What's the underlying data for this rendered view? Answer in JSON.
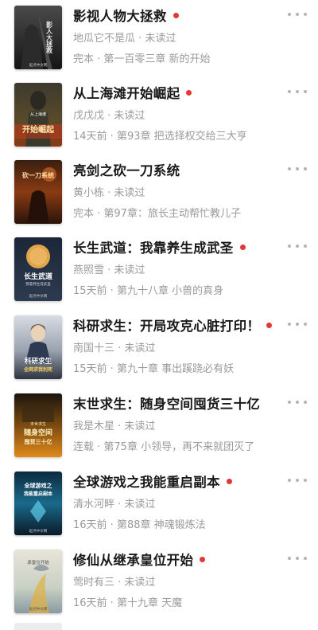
{
  "colors": {
    "accent_dot": "#e23838",
    "meta_text": "#9a9a9a",
    "more_dots": "#b5b5b5"
  },
  "books": [
    {
      "title": "影视人物大拯救",
      "dot": true,
      "meta": "地瓜它不是瓜 · 未读过",
      "progress": "完本 · 第一百零三章 新的开始",
      "cover": {
        "text": "影人大拯救",
        "footer": "起点中文网"
      }
    },
    {
      "title": "从上海滩开始崛起",
      "dot": true,
      "meta": "戊戊戊 · 未读过",
      "progress": "14天前 · 第93章 把选择权交给三大亨",
      "cover": {
        "text": "开始崛起",
        "top": "从上海滩"
      }
    },
    {
      "title": "亮剑之砍一刀系统",
      "dot": false,
      "meta": "黄小栋 · 未读过",
      "progress": "完本 · 第97章：旅长主动帮忙教儿子",
      "cover": {
        "text": "砍一刀系统"
      }
    },
    {
      "title": "长生武道：我靠养生成武圣",
      "dot": true,
      "meta": "燕照雪 · 未读过",
      "progress": "15天前 · 第九十八章 小兽的真身",
      "cover": {
        "text": "长生武道",
        "sub": "我靠养生成武圣",
        "footer": "起点中文网"
      }
    },
    {
      "title": "科研求生：开局攻克心脏打印！",
      "dot": true,
      "meta": "南国十三 · 未读过",
      "progress": "15天前 · 第九十章 事出蹊跷必有妖",
      "cover": {
        "text": "科研求生",
        "sub": "全网求我别死"
      }
    },
    {
      "title": "末世求生：随身空间囤货三十亿",
      "dot": false,
      "meta": "我是木星 · 未读过",
      "progress": "连载 · 第75章 小领导，再不来就团灭了",
      "cover": {
        "text": "随身空间",
        "sub": "囤货三十亿",
        "top": "末世求生"
      }
    },
    {
      "title": "全球游戏之我能重启副本",
      "dot": true,
      "meta": "清水河畔 · 未读过",
      "progress": "16天前 · 第88章 神魂锻炼法",
      "cover": {
        "text": "全球游戏之",
        "sub": "我能重启副本",
        "footer": "起点中文网"
      }
    },
    {
      "title": "修仙从继承皇位开始",
      "dot": true,
      "meta": "莺时有三 · 未读过",
      "progress": "16天前 · 第十九章 天魔",
      "cover": {
        "text": "承皇位开始",
        "footer": "起点中文网"
      }
    }
  ]
}
